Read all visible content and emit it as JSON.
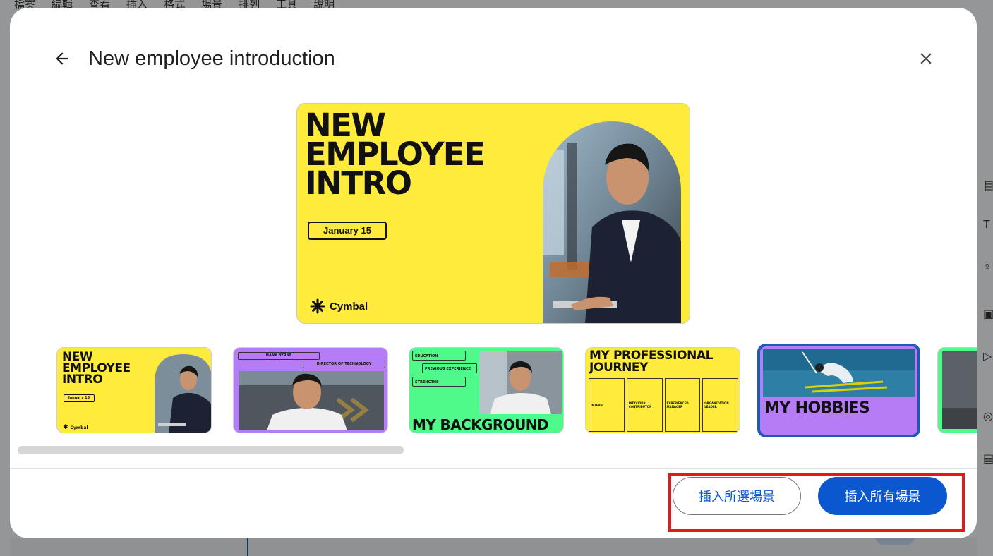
{
  "background": {
    "menu": [
      "檔案",
      "編輯",
      "查看",
      "插入",
      "格式",
      "場景",
      "排列",
      "工具",
      "說明"
    ],
    "rail_glyphs": [
      "目",
      "T",
      "♀",
      "▣",
      "▷",
      "◎",
      "▤"
    ]
  },
  "dialog": {
    "title": "New employee introduction",
    "back_icon": "arrow-back-icon",
    "close_icon": "close-icon"
  },
  "preview": {
    "title": "NEW\nEMPLOYEE\nINTRO",
    "date": "January 15",
    "brand": "Cymbal"
  },
  "thumbnails": {
    "t1": {
      "title": "NEW\nEMPLOYEE\nINTRO",
      "date": "January 15",
      "brand": "Cymbal"
    },
    "t2": {
      "name": "HANK BYRNE",
      "role": "DIRECTOR OF TECHNOLOGY"
    },
    "t3": {
      "items": [
        "EDUCATION",
        "PREVIOUS EXPERIENCE",
        "STRENGTHS"
      ],
      "title": "MY BACKGROUND"
    },
    "t4": {
      "title": "MY PROFESSIONAL\nJOURNEY",
      "steps": [
        "INTERN",
        "INDIVIDUAL CONTRIBUTOR",
        "EXPERIENCED MANAGER",
        "ORGANIZATION LEADER"
      ]
    },
    "t5": {
      "title": "MY HOBBIES"
    }
  },
  "footer": {
    "insert_selected": "插入所選場景",
    "insert_all": "插入所有場景"
  },
  "colors": {
    "yellow": "#ffeb3b",
    "purple": "#b57cf5",
    "green": "#4dfa8a",
    "primary": "#0b57d0",
    "selected_border": "#1f59b8",
    "highlight": "#e5161c"
  }
}
